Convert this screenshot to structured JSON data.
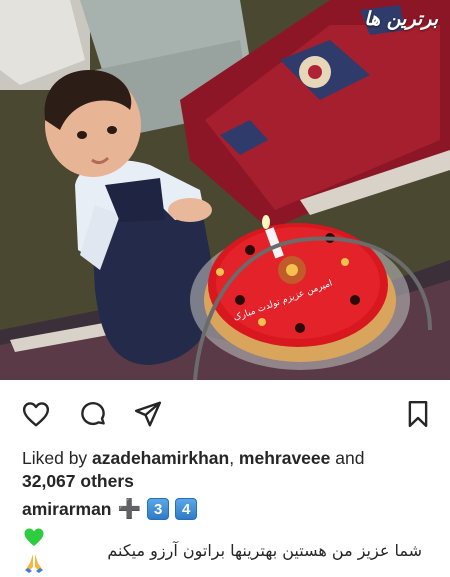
{
  "photo": {
    "watermark": "برترین ها",
    "cake_text": "امیرمن عزیزم تولدت مبارک"
  },
  "actions": {
    "like_icon": "heart-outline-icon",
    "comment_icon": "comment-bubble-icon",
    "share_icon": "paper-plane-icon",
    "save_icon": "bookmark-icon"
  },
  "likes": {
    "prefix": "Liked by ",
    "user1": "azadehamirkhan",
    "separator": ", ",
    "user2": "mehraveee",
    "joiner": " and",
    "count": "32,067 others"
  },
  "caption": {
    "username": "amirarman",
    "plus": "➕",
    "digit1": "3",
    "digit2": "4",
    "text": "شما عزیز من هستین بهترینها براتون آرزو میکنم",
    "heart_color": "#2ecc40"
  }
}
